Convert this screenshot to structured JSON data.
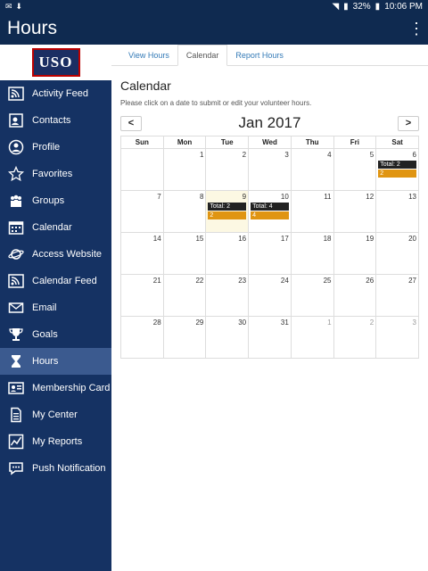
{
  "status": {
    "battery": "32%",
    "time": "10:06 PM"
  },
  "app": {
    "title": "Hours",
    "logo": "USO"
  },
  "sidebar": {
    "items": [
      {
        "label": "Activity Feed",
        "icon": "feed-icon"
      },
      {
        "label": "Contacts",
        "icon": "contacts-icon"
      },
      {
        "label": "Profile",
        "icon": "profile-icon"
      },
      {
        "label": "Favorites",
        "icon": "star-icon"
      },
      {
        "label": "Groups",
        "icon": "groups-icon"
      },
      {
        "label": "Calendar",
        "icon": "calendar-icon"
      },
      {
        "label": "Access Website",
        "icon": "planet-icon"
      },
      {
        "label": "Calendar Feed",
        "icon": "rss-icon"
      },
      {
        "label": "Email",
        "icon": "email-icon"
      },
      {
        "label": "Goals",
        "icon": "trophy-icon"
      },
      {
        "label": "Hours",
        "icon": "hourglass-icon"
      },
      {
        "label": "Membership Card",
        "icon": "id-card-icon"
      },
      {
        "label": "My Center",
        "icon": "document-icon"
      },
      {
        "label": "My Reports",
        "icon": "chart-icon"
      },
      {
        "label": "Push Notification",
        "icon": "chat-icon"
      }
    ],
    "active_index": 10
  },
  "tabs": [
    "View Hours",
    "Calendar",
    "Report Hours"
  ],
  "page": {
    "title": "Calendar",
    "subtitle": "Please click on a date to submit or edit your volunteer hours."
  },
  "calendar": {
    "prev": "<",
    "next": ">",
    "month": "Jan 2017",
    "weekdays": [
      "Sun",
      "Mon",
      "Tue",
      "Wed",
      "Thu",
      "Fri",
      "Sat"
    ],
    "weeks": [
      [
        {
          "d": "",
          "o": false
        },
        {
          "d": "1",
          "o": false
        },
        {
          "d": "2",
          "o": false
        },
        {
          "d": "3",
          "o": false
        },
        {
          "d": "4",
          "o": false
        },
        {
          "d": "5",
          "o": false
        },
        {
          "d": "6",
          "o": false,
          "total": "Total: 2",
          "hours": "2"
        }
      ],
      [
        {
          "d": "7",
          "o": false
        },
        {
          "d": "8",
          "o": false
        },
        {
          "d": "9",
          "o": false,
          "today": true,
          "total": "Total: 2",
          "hours": "2"
        },
        {
          "d": "10",
          "o": false,
          "total": "Total: 4",
          "hours": "4"
        },
        {
          "d": "11",
          "o": false
        },
        {
          "d": "12",
          "o": false
        },
        {
          "d": "13",
          "o": false
        }
      ],
      [
        {
          "d": "14",
          "o": false
        },
        {
          "d": "15",
          "o": false
        },
        {
          "d": "16",
          "o": false
        },
        {
          "d": "17",
          "o": false
        },
        {
          "d": "18",
          "o": false
        },
        {
          "d": "19",
          "o": false
        },
        {
          "d": "20",
          "o": false
        }
      ],
      [
        {
          "d": "21",
          "o": false
        },
        {
          "d": "22",
          "o": false
        },
        {
          "d": "23",
          "o": false
        },
        {
          "d": "24",
          "o": false
        },
        {
          "d": "25",
          "o": false
        },
        {
          "d": "26",
          "o": false
        },
        {
          "d": "27",
          "o": false
        }
      ],
      [
        {
          "d": "28",
          "o": false
        },
        {
          "d": "29",
          "o": false
        },
        {
          "d": "30",
          "o": false
        },
        {
          "d": "31",
          "o": false
        },
        {
          "d": "1",
          "o": true
        },
        {
          "d": "2",
          "o": true
        },
        {
          "d": "3",
          "o": true
        }
      ]
    ]
  }
}
